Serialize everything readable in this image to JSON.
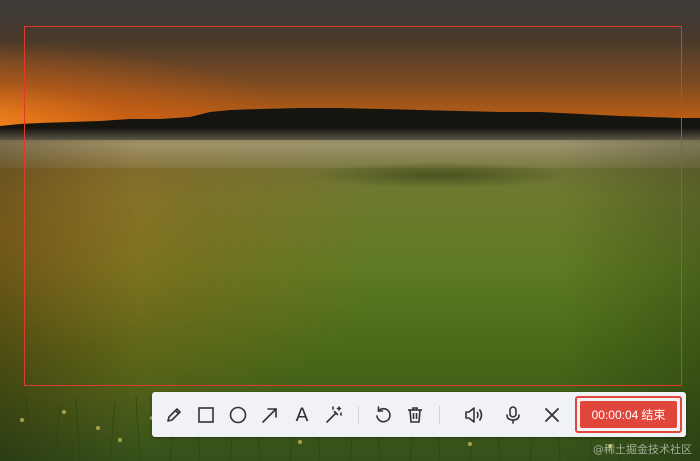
{
  "toolbar": {
    "tools": [
      {
        "name": "pencil-icon",
        "label": ""
      },
      {
        "name": "rectangle-icon",
        "label": ""
      },
      {
        "name": "circle-icon",
        "label": ""
      },
      {
        "name": "arrow-icon",
        "label": ""
      },
      {
        "name": "text-tool-icon",
        "label": "A"
      },
      {
        "name": "magic-wand-icon",
        "label": ""
      },
      {
        "name": "undo-icon",
        "label": ""
      },
      {
        "name": "trash-icon",
        "label": ""
      },
      {
        "name": "speaker-icon",
        "label": ""
      },
      {
        "name": "microphone-icon",
        "label": ""
      },
      {
        "name": "close-icon",
        "label": ""
      }
    ],
    "text_tool_label": "A",
    "timer": "00:00:04",
    "end_label": "结束"
  },
  "selection": {
    "border_color": "#e03a2f"
  },
  "colors": {
    "accent": "#e1463a",
    "toolbar_bg": "#f0f2f5",
    "icon": "#333333"
  },
  "watermark": "@稀土掘金技术社区"
}
